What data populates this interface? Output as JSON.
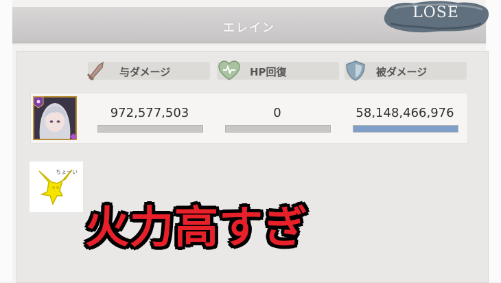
{
  "header": {
    "title": "エレイン"
  },
  "result": {
    "label": "LOSE"
  },
  "columns": [
    {
      "label": "与ダメージ",
      "icon": "sword-icon"
    },
    {
      "label": "HP回復",
      "icon": "heart-icon"
    },
    {
      "label": "被ダメージ",
      "icon": "shield-icon"
    }
  ],
  "rows": [
    {
      "character": "エレイン",
      "dealt": "972,577,503",
      "healed": "0",
      "taken": "58,148,466,976",
      "bars": {
        "dealt": 0,
        "healed": 0,
        "taken": 1
      }
    }
  ],
  "sticker": {
    "text": "ちょーい"
  },
  "caption": {
    "text": "火力高すぎ"
  },
  "colors": {
    "accent": "#e8202a",
    "bar_fill": "#7f9ec8",
    "bar_empty": "#c8c7c6",
    "portrait_frame": "#b98d34"
  }
}
